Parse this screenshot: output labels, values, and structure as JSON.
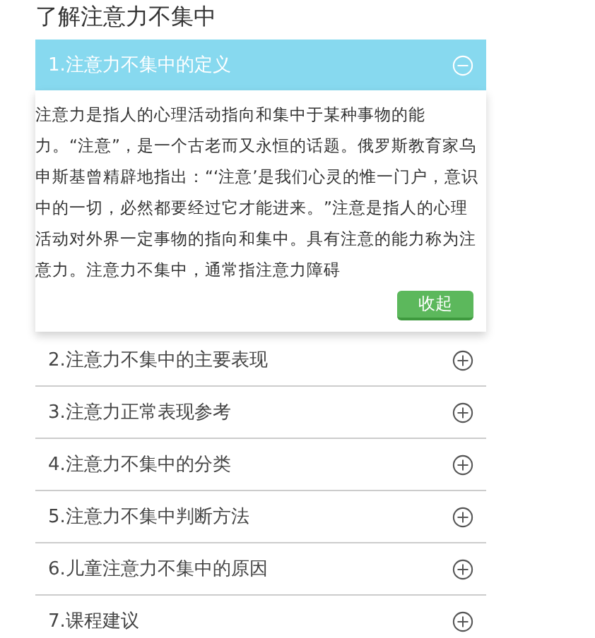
{
  "title": "了解注意力不集中",
  "sections": [
    {
      "label": "1.注意力不集中的定义",
      "expanded": true,
      "body": "注意力是指人的心理活动指向和集中于某种事物的能力。“注意”，是一个古老而又永恒的话题。俄罗斯教育家乌申斯基曾精辟地指出：“‘注意’是我们心灵的惟一门户，意识中的一切，必然都要经过它才能进来。”注意是指人的心理活动对外界一定事物的指向和集中。具有注意的能力称为注意力。注意力不集中，通常指注意力障碍",
      "collapse_button": "收起"
    },
    {
      "label": "2.注意力不集中的主要表现",
      "expanded": false
    },
    {
      "label": "3.注意力正常表现参考",
      "expanded": false
    },
    {
      "label": "4.注意力不集中的分类",
      "expanded": false
    },
    {
      "label": "5.注意力不集中判断方法",
      "expanded": false
    },
    {
      "label": "6.儿童注意力不集中的原因",
      "expanded": false
    },
    {
      "label": "7.课程建议",
      "expanded": false
    }
  ]
}
